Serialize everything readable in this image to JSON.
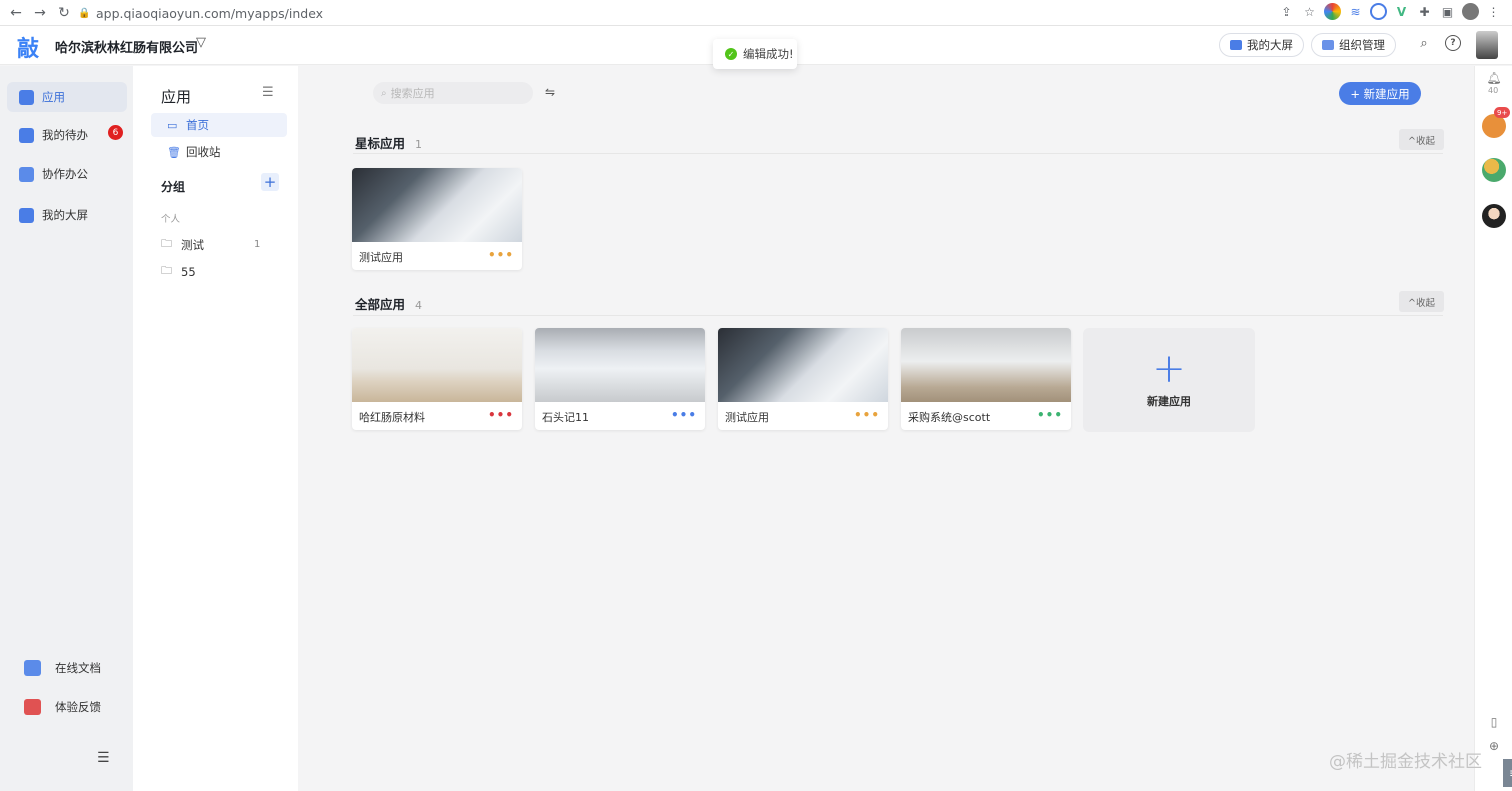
{
  "browser": {
    "url": "app.qiaoqiaoyun.com/myapps/index"
  },
  "header": {
    "logo_char": "敲",
    "company": "哈尔滨秋林红肠有限公司",
    "toast": "编辑成功!",
    "big_screen_label": "我的大屏",
    "org_manage_label": "组织管理",
    "accent_color": "#4a7de6"
  },
  "leftnav": {
    "items": [
      {
        "label": "应用",
        "icon": "cube-icon",
        "active": true
      },
      {
        "label": "我的待办",
        "icon": "todo-icon",
        "badge": "6"
      },
      {
        "label": "协作办公",
        "icon": "collab-icon"
      },
      {
        "label": "我的大屏",
        "icon": "screen-icon"
      }
    ],
    "bottom": [
      {
        "label": "在线文档",
        "icon": "document-icon"
      },
      {
        "label": "体验反馈",
        "icon": "feedback-icon"
      }
    ]
  },
  "secnav": {
    "title": "应用",
    "items": [
      {
        "label": "首页",
        "icon": "home-icon",
        "active": true
      },
      {
        "label": "回收站",
        "icon": "trash-icon"
      }
    ],
    "group_title": "分组",
    "add_group": "+",
    "personal_label": "个人",
    "folders": [
      {
        "label": "测试",
        "count": "1"
      },
      {
        "label": "55",
        "count": ""
      }
    ]
  },
  "main": {
    "search_placeholder": "搜索应用",
    "new_app_button": "+ 新建应用",
    "starred": {
      "title": "星标应用",
      "count": "1",
      "fold_label": "^收起",
      "apps": [
        {
          "name": "测试应用",
          "dots_color": "#e8a33d"
        }
      ]
    },
    "all": {
      "title": "全部应用",
      "count": "4",
      "fold_label": "^收起",
      "apps": [
        {
          "name": "哈红肠原材料",
          "dots_color": "#d9363e"
        },
        {
          "name": "石头记11",
          "dots_color": "#4a7de6"
        },
        {
          "name": "测试应用",
          "dots_color": "#e8a33d"
        },
        {
          "name": "采购系统@scott",
          "dots_color": "#3cb371"
        }
      ],
      "new_card_label": "新建应用"
    }
  },
  "rightbar": {
    "notification_count": "40",
    "app_badge": "9+"
  },
  "watermark": "@稀土掘金技术社区"
}
